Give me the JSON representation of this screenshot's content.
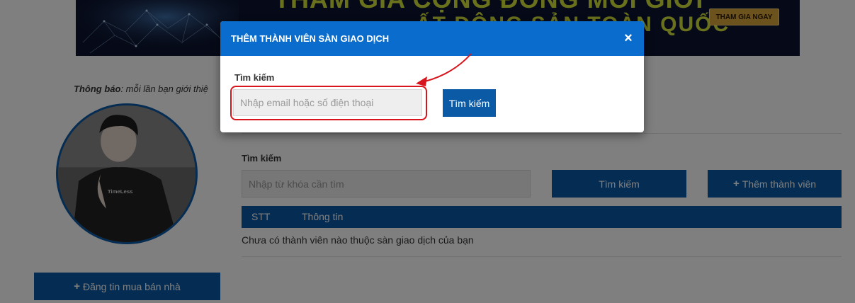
{
  "banner": {
    "line1": "THAM GIA CỘNG ĐỒNG MÔI GIỚI",
    "line2": "ẤT ĐỘNG SẢN TOÀN QUỐC",
    "cta_label": "THAM GIA NGAY"
  },
  "notice": {
    "label": "Thông báo",
    "text": ": mỗi lần bạn giới thiệ"
  },
  "sidebar": {
    "post_button_label": "Đăng tin mua bán nhà"
  },
  "members": {
    "search_label": "Tìm kiếm",
    "search_placeholder": "Nhập từ khóa cần tìm",
    "search_button_label": "Tìm kiếm",
    "add_button_label": "Thêm thành viên",
    "table_headers": [
      "STT",
      "Thông tin"
    ],
    "empty_message": "Chưa có thành viên nào thuộc sàn giao dịch của bạn"
  },
  "modal": {
    "title": "THÊM THÀNH VIÊN SÀN GIAO DỊCH",
    "close_glyph": "×",
    "search_label": "Tìm kiếm",
    "input_placeholder": "Nhập email hoặc số điện thoại",
    "search_button_label": "Tìm kiếm"
  },
  "avatar": {
    "shirt_text": "TimeLess"
  },
  "colors": {
    "primary": "#0a5aa6",
    "modal_header": "#0a6ccc",
    "annotation": "#d8141c",
    "banner_text": "#d4e23a",
    "banner_cta": "#d9a53a"
  },
  "icons": {
    "plus": "+",
    "close": "×"
  }
}
